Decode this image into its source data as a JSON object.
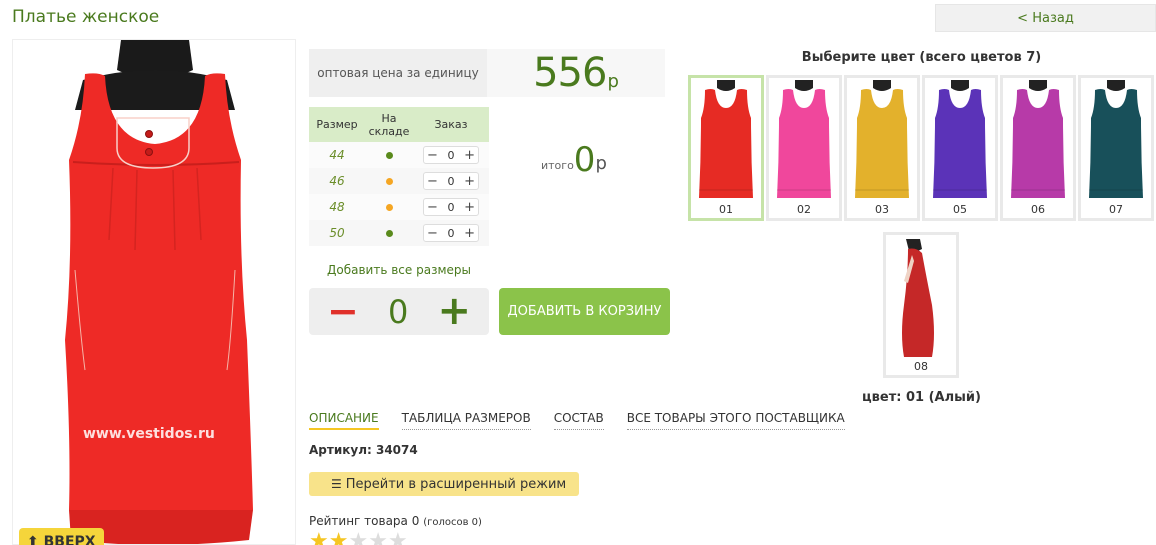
{
  "page": {
    "title": "Платье женское"
  },
  "nav": {
    "back_label": "< Назад"
  },
  "photo": {
    "watermark": "www.vestidos.ru",
    "color": "#ee2a26"
  },
  "up_button": {
    "label": "⬆ ВВЕРХ"
  },
  "price": {
    "label": "оптовая цена за единицу",
    "value": "556",
    "currency": "р"
  },
  "sizes": {
    "headers": [
      "Размер",
      "На складе",
      "Заказ"
    ],
    "rows": [
      {
        "size": "44",
        "stock_color": "#5a8a1c",
        "qty": "0"
      },
      {
        "size": "46",
        "stock_color": "#f5a623",
        "qty": "0"
      },
      {
        "size": "48",
        "stock_color": "#f5a623",
        "qty": "0"
      },
      {
        "size": "50",
        "stock_color": "#5a8a1c",
        "qty": "0"
      }
    ],
    "minus": "−",
    "plus": "+"
  },
  "total": {
    "label": "итого",
    "value": "0",
    "currency": "р"
  },
  "order": {
    "add_all_label": "Добавить все размеры",
    "quantity": "0",
    "minus": "−",
    "plus": "+",
    "cart_label": "ДОБАВИТЬ В КОРЗИНУ"
  },
  "colors": {
    "header": "Выберите цвет (всего цветов 7)",
    "items": [
      {
        "code": "01",
        "hex": "#e62b24"
      },
      {
        "code": "02",
        "hex": "#f0479c"
      },
      {
        "code": "03",
        "hex": "#e3b12c"
      },
      {
        "code": "05",
        "hex": "#5b33b8"
      },
      {
        "code": "06",
        "hex": "#b73aa8"
      },
      {
        "code": "07",
        "hex": "#18505a"
      },
      {
        "code": "08",
        "hex": "#c52828"
      }
    ],
    "footer": "цвет: 01 (Алый)"
  },
  "tabs": [
    "ОПИСАНИЕ",
    "ТАБЛИЦА РАЗМЕРОВ",
    "СОСТАВ",
    "ВСЕ ТОВАРЫ ЭТОГО ПОСТАВЩИКА"
  ],
  "article": {
    "text": "Артикул: 34074"
  },
  "advanced": {
    "label": "Перейти в расширенный режим"
  },
  "rating": {
    "label": "Рейтинг товара 0",
    "votes": "(голосов 0)"
  },
  "accent": {
    "green": "#4a7a1e",
    "yellow": "#f5d53b",
    "button_green": "#8bc34a"
  }
}
